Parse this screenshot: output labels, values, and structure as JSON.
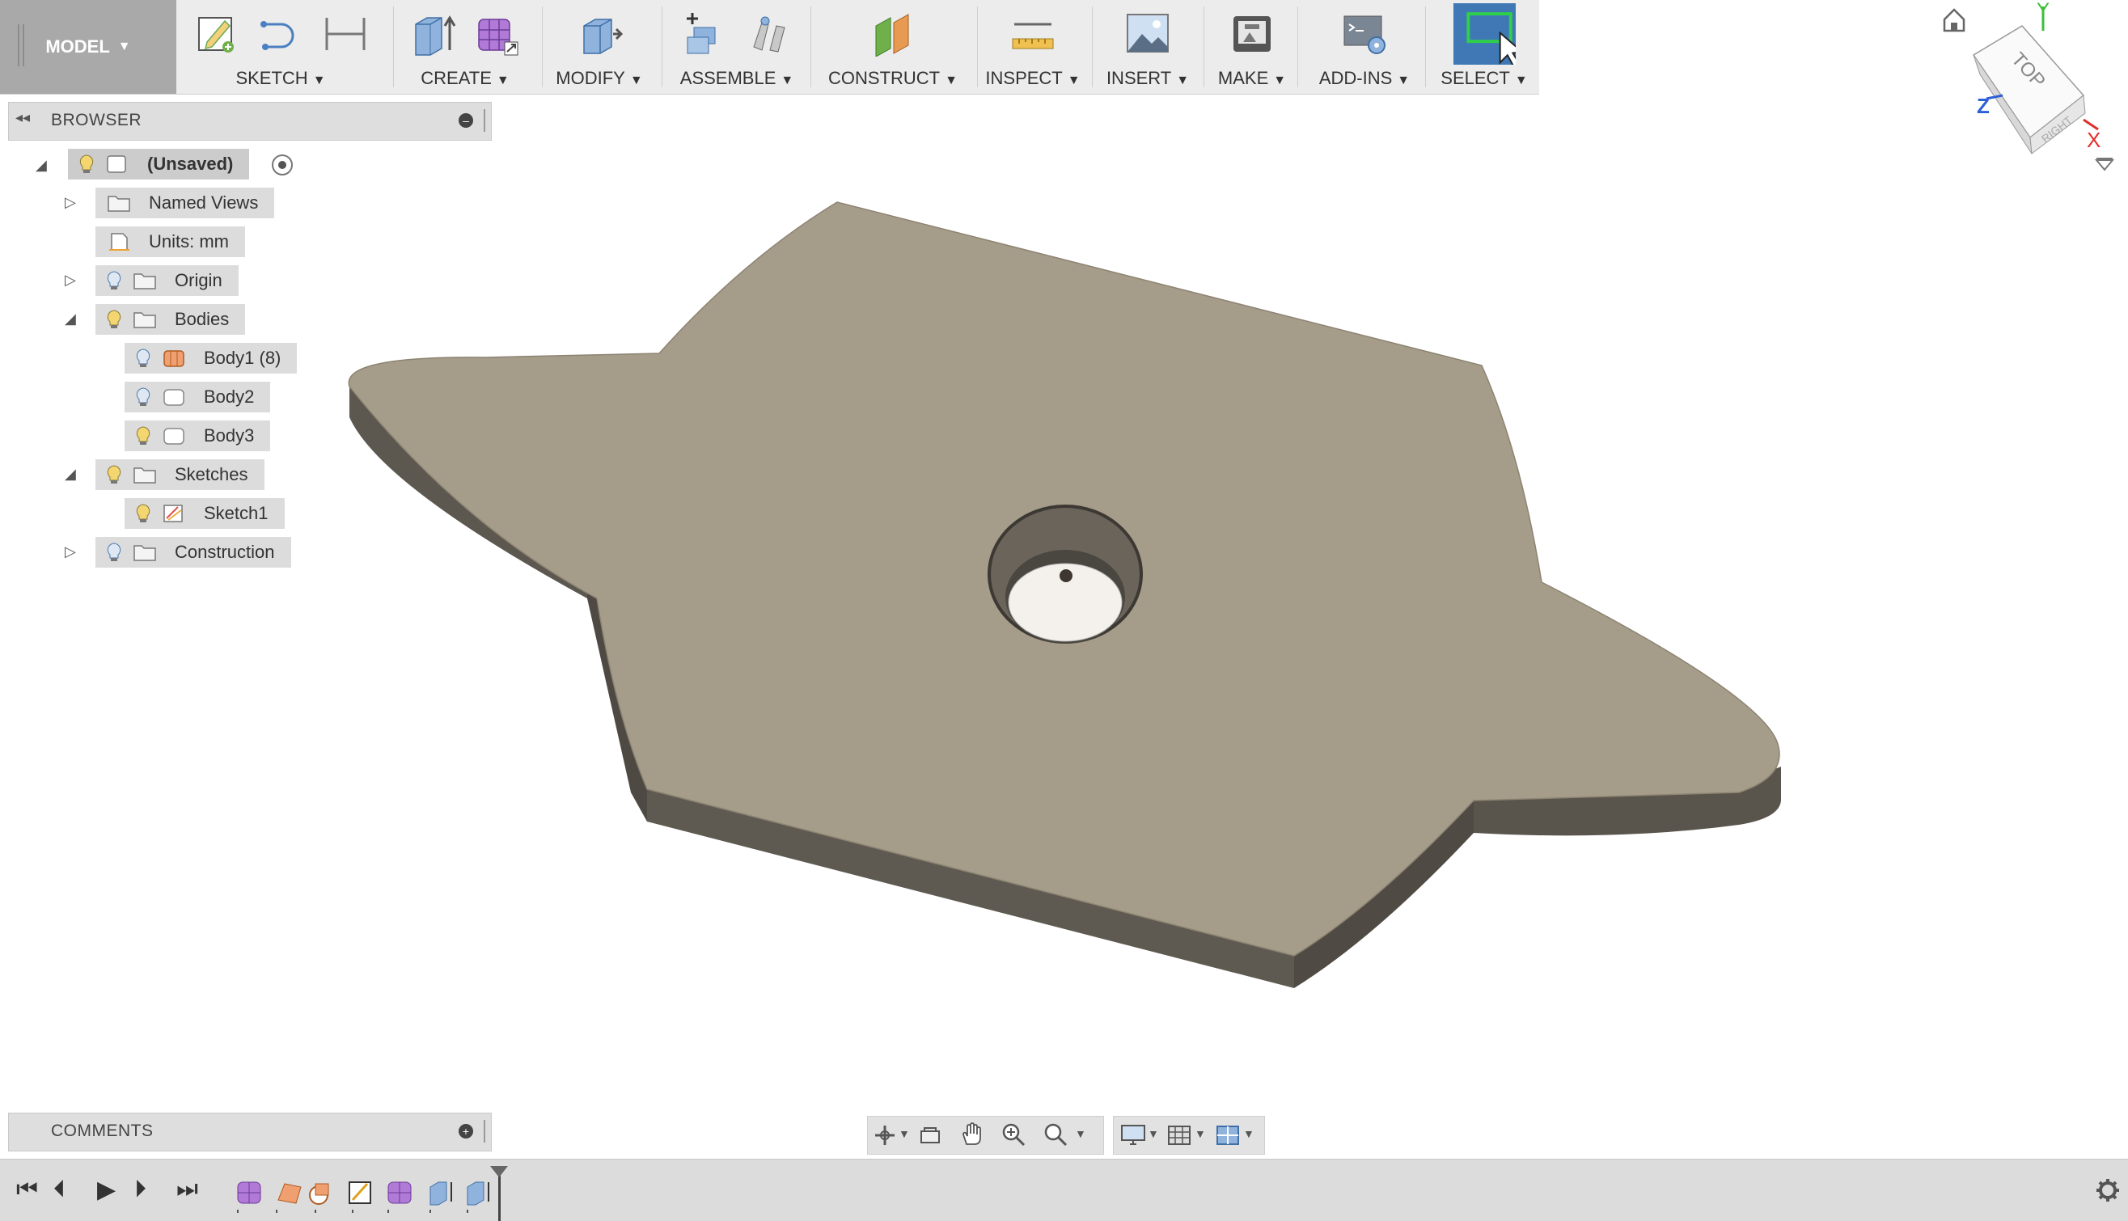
{
  "toolbar": {
    "workspace_label": "MODEL",
    "groups": [
      {
        "label": "SKETCH"
      },
      {
        "label": "CREATE"
      },
      {
        "label": "MODIFY"
      },
      {
        "label": "ASSEMBLE"
      },
      {
        "label": "CONSTRUCT"
      },
      {
        "label": "INSPECT"
      },
      {
        "label": "INSERT"
      },
      {
        "label": "MAKE"
      },
      {
        "label": "ADD-INS"
      },
      {
        "label": "SELECT"
      }
    ],
    "caret": "▼"
  },
  "browser": {
    "title": "BROWSER",
    "root": "(Unsaved)",
    "items": [
      {
        "label": "Named Views"
      },
      {
        "label": "Units: mm"
      },
      {
        "label": "Origin"
      },
      {
        "label": "Bodies"
      },
      {
        "label": "Body1 (8)"
      },
      {
        "label": "Body2"
      },
      {
        "label": "Body3"
      },
      {
        "label": "Sketches"
      },
      {
        "label": "Sketch1"
      },
      {
        "label": "Construction"
      }
    ]
  },
  "comments": {
    "title": "COMMENTS"
  },
  "viewcube": {
    "top": "TOP",
    "right": "RIGHT",
    "axis_x": "X",
    "axis_y": "Y",
    "axis_z": "Z"
  },
  "colors": {
    "toolbar_bg": "#ececec",
    "model_bg": "#a9a9a9",
    "body_top": "#a69c8a",
    "body_side": "#5f5a51",
    "select_active": "#3f78b5",
    "axis_x": "#e0302b",
    "axis_y": "#3bbf3b",
    "axis_z": "#2f5fd6"
  }
}
